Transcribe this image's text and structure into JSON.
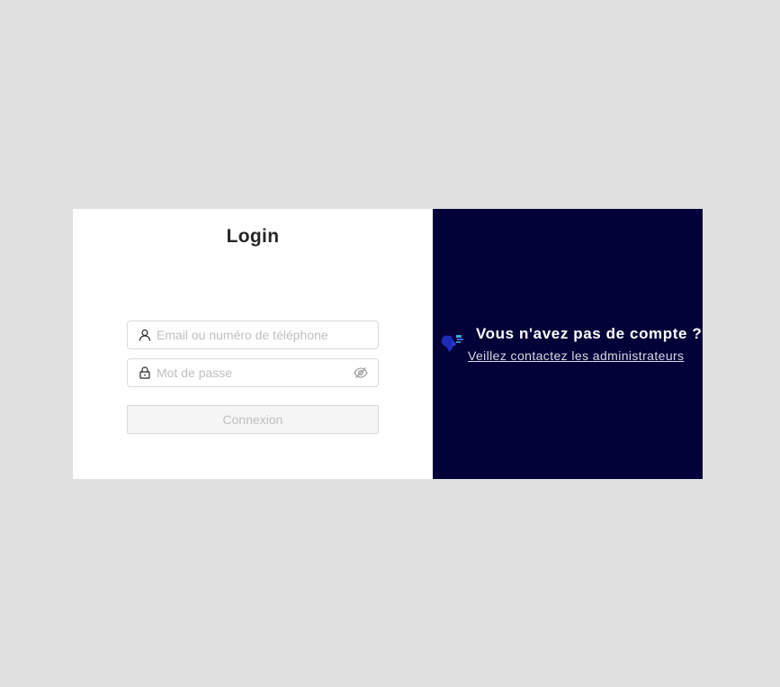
{
  "login": {
    "title": "Login",
    "email_placeholder": "Email ou numéro de téléphone",
    "password_placeholder": "Mot de passe",
    "submit_label": "Connexion"
  },
  "side": {
    "heading": "Vous n'avez pas de compte ?",
    "link_label": "Veillez contactez les administrateurs"
  },
  "icons": {
    "email_prefix": "user-icon",
    "password_prefix": "lock-icon",
    "password_toggle": "eye-invisible-icon",
    "brand": "logo-icon"
  },
  "colors": {
    "page_background": "#e0e0e0",
    "right_panel": "#020138",
    "input_border": "#d9d9d9",
    "placeholder": "#bfbfbf"
  }
}
